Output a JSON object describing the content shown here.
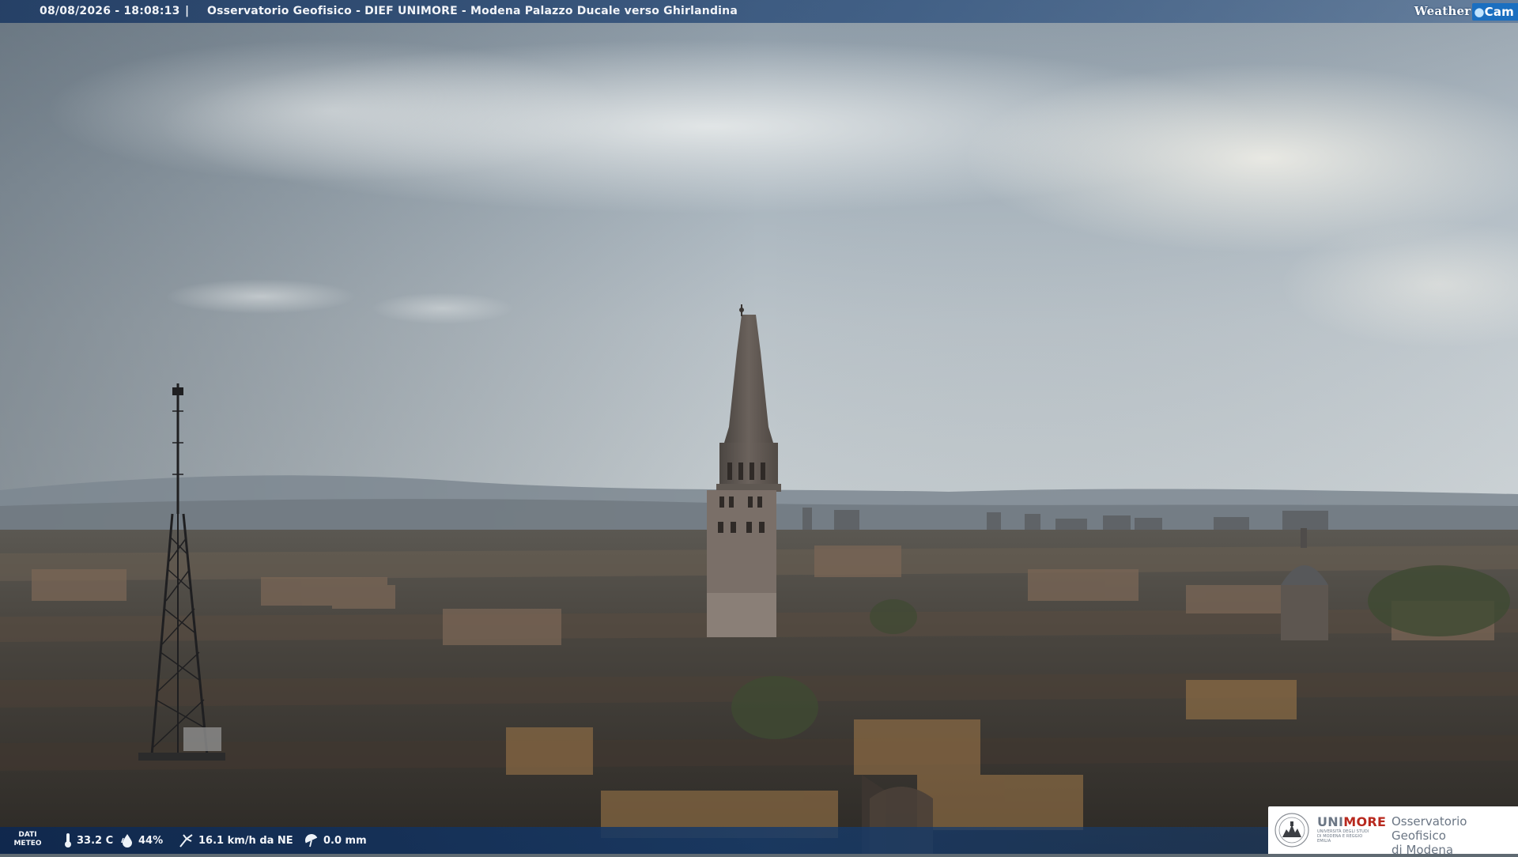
{
  "top_bar": {
    "timestamp": "08/08/2026 - 18:08:13",
    "separator": "|",
    "title": "Osservatorio Geofisico - DIEF UNIMORE - Modena Palazzo Ducale verso Ghirlandina",
    "brand_weather": "Weather",
    "brand_cam": "Cam"
  },
  "bottom_bar": {
    "dati_line1": "DATI",
    "dati_line2": "METEO",
    "temperature": "33.2 C",
    "humidity": "44%",
    "wind": "16.1 km/h da NE",
    "rain": "0.0 mm"
  },
  "logo": {
    "uni_a": "UNI",
    "uni_b": "MORE",
    "uni_sub": "UNIVERSITÀ DEGLI STUDI DI MODENA E REGGIO EMILIA",
    "org_line1": "Osservatorio Geofisico",
    "org_line2": "di Modena"
  },
  "icons": {
    "temperature": "thermometer-icon",
    "humidity": "drop-icon",
    "wind": "wind-icon",
    "rain": "umbrella-icon"
  }
}
